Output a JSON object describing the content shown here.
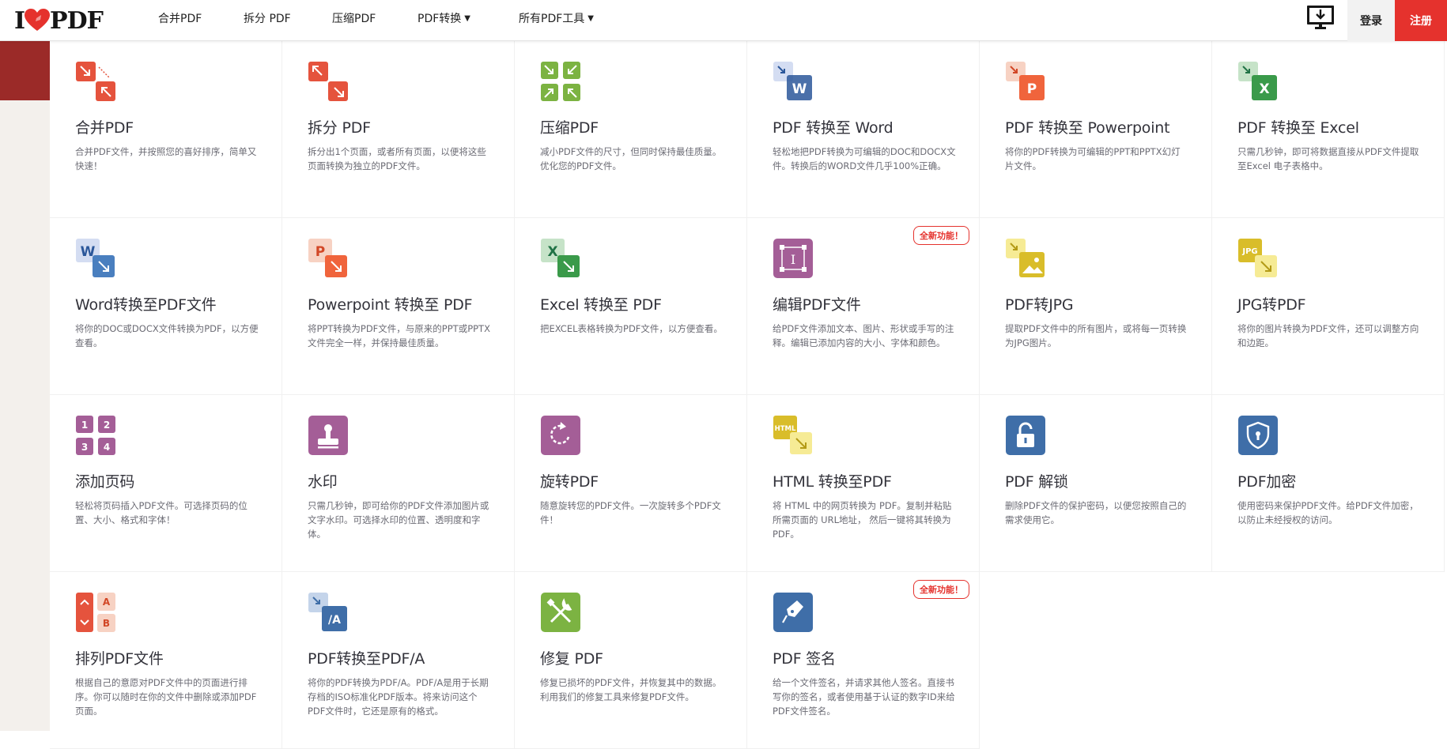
{
  "header": {
    "logo_left": "I",
    "logo_right": "PDF",
    "nav": [
      {
        "label": "合并PDF",
        "caret": false
      },
      {
        "label": "拆分 PDF",
        "caret": false
      },
      {
        "label": "压缩PDF",
        "caret": false
      },
      {
        "label": "PDF转换",
        "caret": true
      },
      {
        "label": "所有PDF工具",
        "caret": true
      }
    ],
    "login": "登录",
    "register": "注册"
  },
  "colors": {
    "brand": "#e5322d",
    "orange": "#e5322d",
    "green": "#7cb342",
    "blue": "#4a7fbf",
    "purple": "#a45e97"
  },
  "tools": [
    {
      "title": "合并PDF",
      "desc": "合并PDF文件，并按照您的喜好排序，简单又快速！",
      "icon": "merge-icon",
      "badge": ""
    },
    {
      "title": "拆分 PDF",
      "desc": "拆分出1个页面，或者所有页面，以便将这些页面转换为独立的PDF文件。",
      "icon": "split-icon",
      "badge": ""
    },
    {
      "title": "压缩PDF",
      "desc": "减小PDF文件的尺寸，但同时保持最佳质量。优化您的PDF文件。",
      "icon": "compress-icon",
      "badge": ""
    },
    {
      "title": "PDF 转换至 Word",
      "desc": "轻松地把PDF转换为可编辑的DOC和DOCX文件。转换后的WORD文件几乎100%正确。",
      "icon": "pdf-to-word-icon",
      "badge": ""
    },
    {
      "title": "PDF 转换至 Powerpoint",
      "desc": "将你的PDF转换为可编辑的PPT和PPTX幻灯片文件。",
      "icon": "pdf-to-powerpoint-icon",
      "badge": ""
    },
    {
      "title": "PDF 转换至 Excel",
      "desc": "只需几秒钟，即可将数据直接从PDF文件提取至Excel 电子表格中。",
      "icon": "pdf-to-excel-icon",
      "badge": ""
    },
    {
      "title": "Word转换至PDF文件",
      "desc": "将你的DOC或DOCX文件转换为PDF，以方便查看。",
      "icon": "word-to-pdf-icon",
      "badge": ""
    },
    {
      "title": "Powerpoint 转换至 PDF",
      "desc": "将PPT转换为PDF文件，与原来的PPT或PPTX文件完全一样，并保持最佳质量。",
      "icon": "powerpoint-to-pdf-icon",
      "badge": ""
    },
    {
      "title": "Excel 转换至 PDF",
      "desc": "把EXCEL表格转换为PDF文件，以方便查看。",
      "icon": "excel-to-pdf-icon",
      "badge": ""
    },
    {
      "title": "编辑PDF文件",
      "desc": "给PDF文件添加文本、图片、形状或手写的注释。编辑已添加内容的大小、字体和颜色。",
      "icon": "edit-pdf-icon",
      "badge": "全新功能！"
    },
    {
      "title": "PDF转JPG",
      "desc": "提取PDF文件中的所有图片，或将每一页转换为JPG图片。",
      "icon": "pdf-to-jpg-icon",
      "badge": ""
    },
    {
      "title": "JPG转PDF",
      "desc": "将你的图片转换为PDF文件，还可以调整方向和边距。",
      "icon": "jpg-to-pdf-icon",
      "badge": ""
    },
    {
      "title": "添加页码",
      "desc": "轻松将页码插入PDF文件。可选择页码的位置、大小、格式和字体！",
      "icon": "page-numbers-icon",
      "badge": ""
    },
    {
      "title": "水印",
      "desc": "只需几秒钟，即可给你的PDF文件添加图片或文字水印。可选择水印的位置、透明度和字体。",
      "icon": "watermark-icon",
      "badge": ""
    },
    {
      "title": "旋转PDF",
      "desc": "随意旋转您的PDF文件。一次旋转多个PDF文件！",
      "icon": "rotate-icon",
      "badge": ""
    },
    {
      "title": "HTML 转换至PDF",
      "desc": "将 HTML 中的网页转换为 PDF。复制并粘贴所需页面的 URL地址， 然后一键将其转换为 PDF。",
      "icon": "html-to-pdf-icon",
      "badge": ""
    },
    {
      "title": "PDF 解锁",
      "desc": "删除PDF文件的保护密码，以便您按照自己的需求使用它。",
      "icon": "unlock-icon",
      "badge": ""
    },
    {
      "title": "PDF加密",
      "desc": "使用密码来保护PDF文件。给PDF文件加密，以防止未经授权的访问。",
      "icon": "protect-icon",
      "badge": ""
    },
    {
      "title": "排列PDF文件",
      "desc": "根据自己的意愿对PDF文件中的页面进行排序。你可以随时在你的文件中删除或添加PDF页面。",
      "icon": "organize-icon",
      "badge": ""
    },
    {
      "title": "PDF转换至PDF/A",
      "desc": "将你的PDF转换为PDF/A。PDF/A是用于长期存档的ISO标准化PDF版本。将来访问这个PDF文件时，它还是原有的格式。",
      "icon": "pdf-to-pdfa-icon",
      "badge": ""
    },
    {
      "title": "修复 PDF",
      "desc": "修复已损坏的PDF文件，并恢复其中的数据。利用我们的修复工具来修复PDF文件。",
      "icon": "repair-icon",
      "badge": ""
    },
    {
      "title": "PDF 签名",
      "desc": "给一个文件签名，并请求其他人签名。直接书写你的签名，或者使用基于认证的数字ID来给PDF文件签名。",
      "icon": "sign-icon",
      "badge": "全新功能！"
    }
  ]
}
